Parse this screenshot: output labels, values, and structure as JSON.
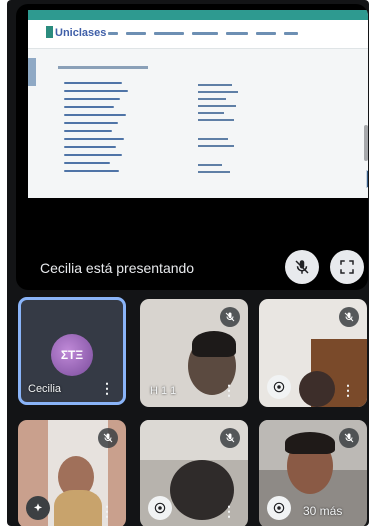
{
  "presentation": {
    "presenter_text": "Cecilia está presentando",
    "shared_site_name": "Uniclases",
    "mute_button_icon": "mic-off-icon",
    "fullscreen_button_icon": "fullscreen-icon"
  },
  "participants": [
    {
      "name": "Cecilia",
      "initials": "ΣΤΞ",
      "muted": true,
      "type": "avatar",
      "active": true
    },
    {
      "name": "H 1 1",
      "muted": true,
      "type": "video"
    },
    {
      "name": "",
      "muted": true,
      "type": "video"
    },
    {
      "name": "",
      "muted": true,
      "type": "video"
    },
    {
      "name": "",
      "muted": true,
      "type": "video"
    },
    {
      "name": "30 más",
      "muted": true,
      "type": "video"
    }
  ],
  "colors": {
    "background": "#131416",
    "tile": "#3c4043",
    "active_outline": "#8ab4f8",
    "avatar": "#a46ac2"
  }
}
